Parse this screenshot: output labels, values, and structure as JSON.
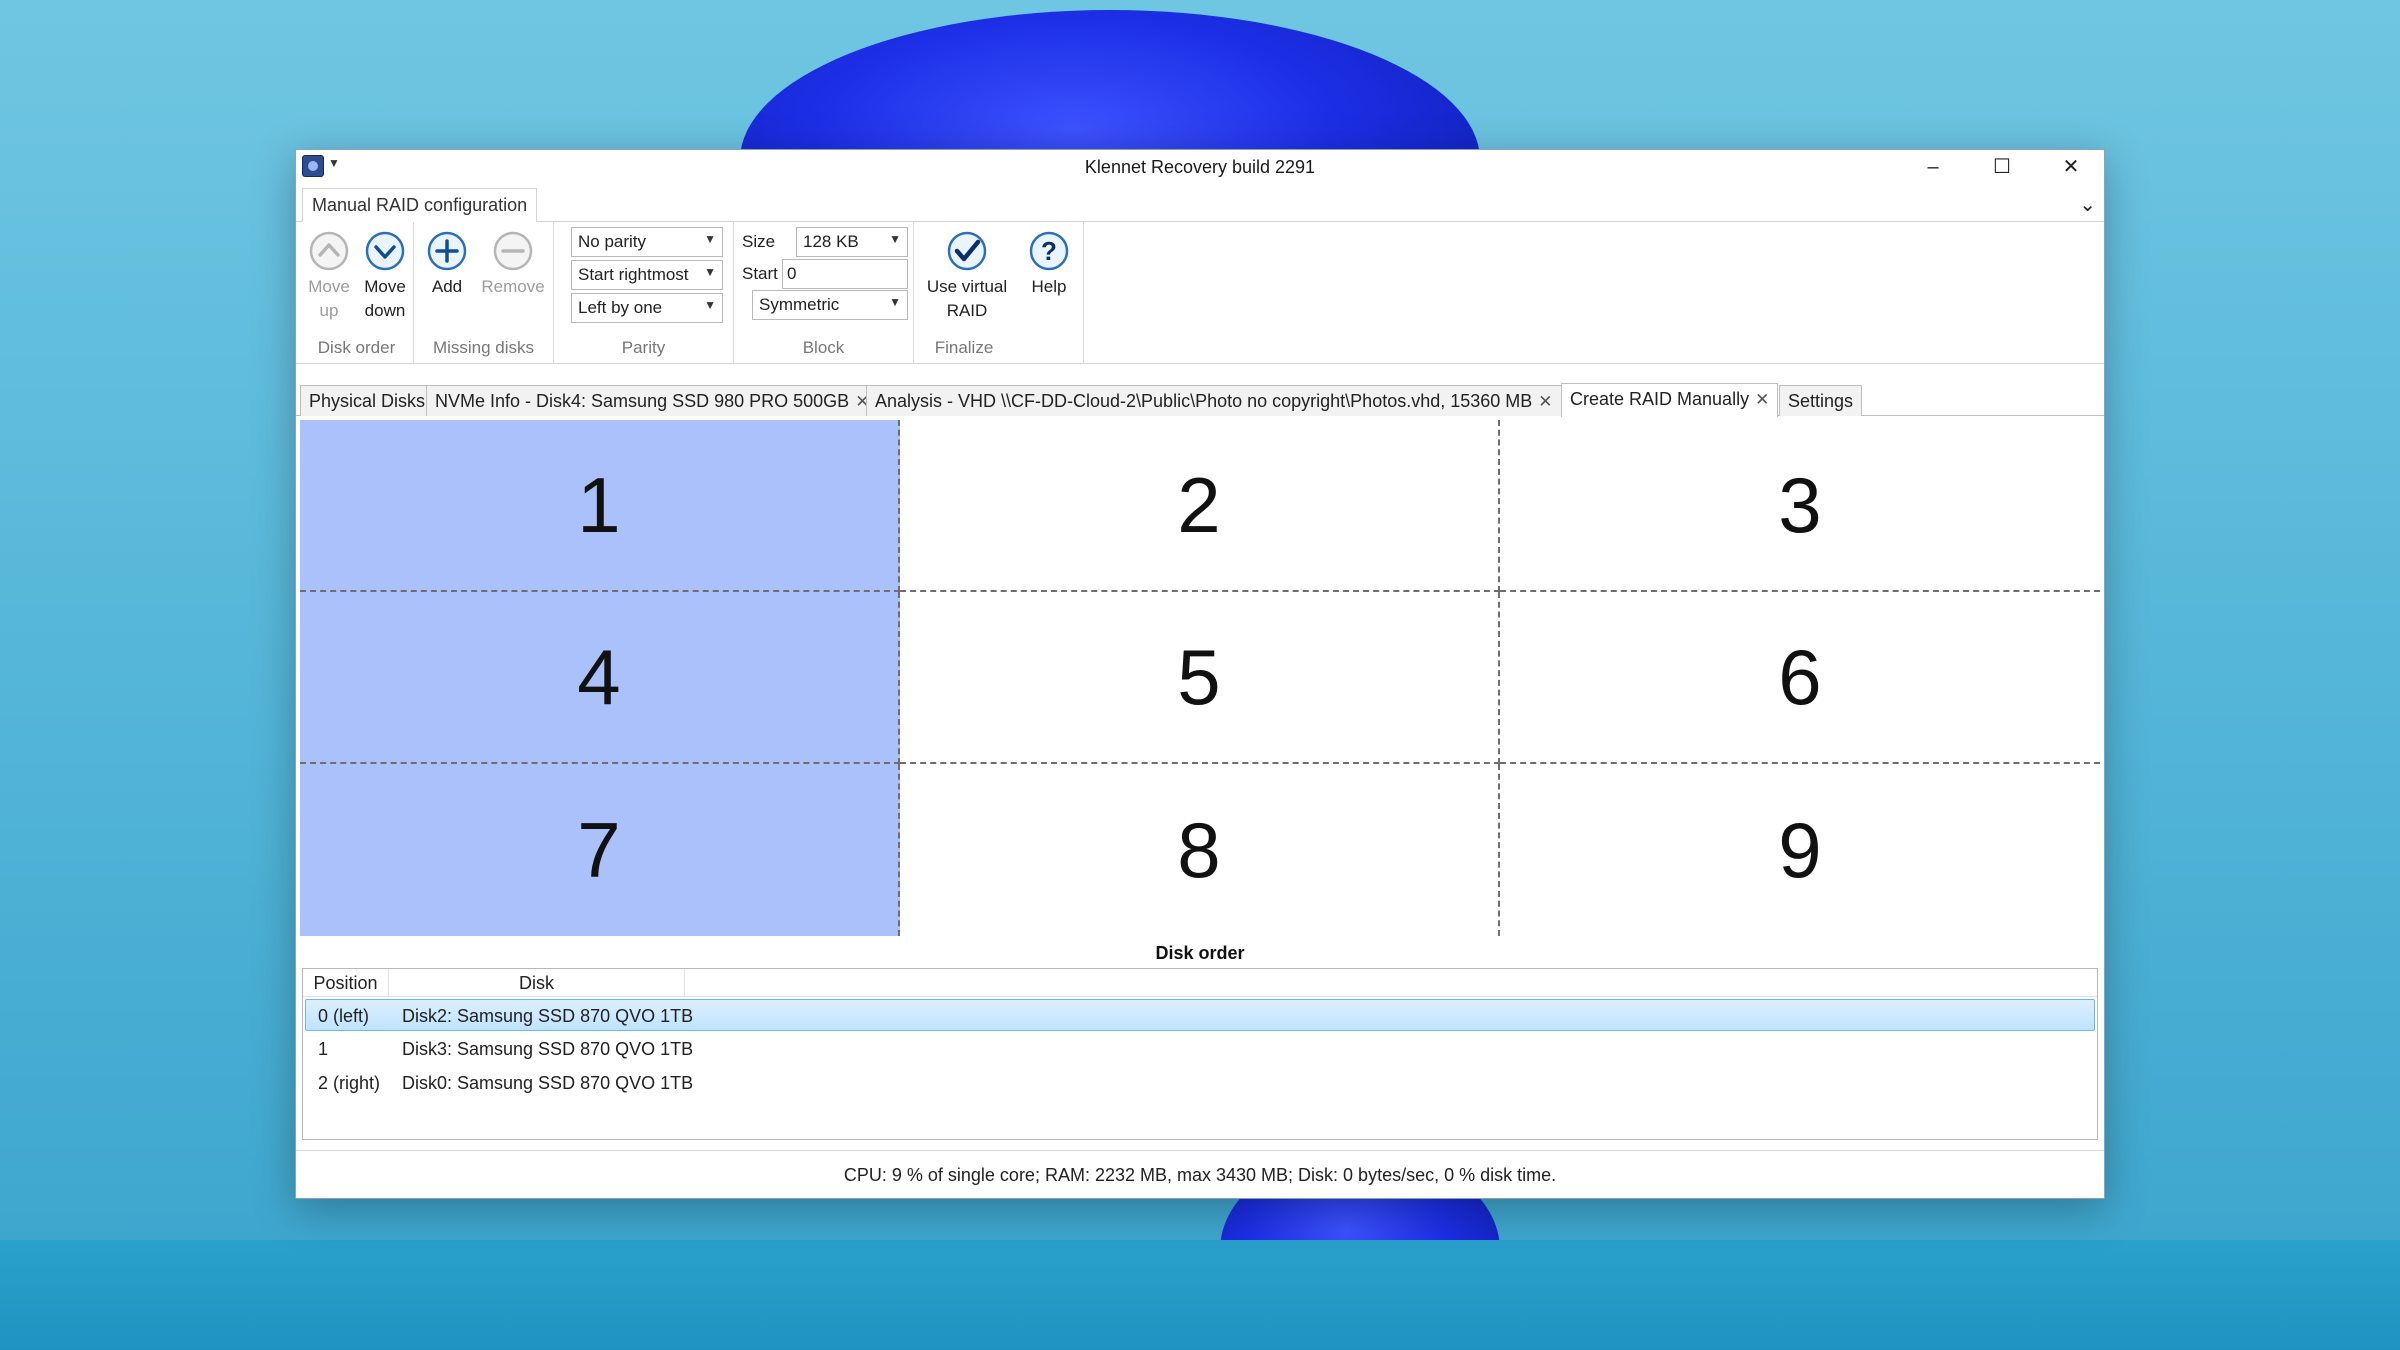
{
  "window": {
    "title": "Klennet Recovery build 2291",
    "minimize": "–",
    "maximize": "☐",
    "close": "✕"
  },
  "ribbon": {
    "tab_label": "Manual RAID configuration",
    "collapse": "⌄",
    "groups": {
      "disk_order": {
        "label": "Disk order",
        "move_up": "Move up",
        "move_down": "Move down"
      },
      "missing_disks": {
        "label": "Missing disks",
        "add": "Add",
        "remove": "Remove"
      },
      "parity": {
        "label": "Parity",
        "parity_type": "No parity",
        "start": "Start rightmost",
        "rotation": "Left by one"
      },
      "block": {
        "label": "Block",
        "size_label": "Size",
        "size_value": "128 KB",
        "start_label": "Start",
        "start_value": "0",
        "layout": "Symmetric"
      },
      "finalize": {
        "label": "Finalize",
        "use_virtual_raid": "Use virtual RAID",
        "help": "Help"
      }
    }
  },
  "doc_tabs": [
    {
      "label": "Physical Disks",
      "closable": false
    },
    {
      "label": "NVMe Info - Disk4:  Samsung SSD 980 PRO 500GB",
      "closable": true
    },
    {
      "label": "Analysis - VHD \\\\CF-DD-Cloud-2\\Public\\Photo no copyright\\Photos.vhd, 15360 MB",
      "closable": true
    },
    {
      "label": "Create RAID Manually",
      "closable": true,
      "active": true
    },
    {
      "label": "Settings",
      "closable": false
    }
  ],
  "stripe_grid": {
    "cells": [
      "1",
      "2",
      "3",
      "4",
      "5",
      "6",
      "7",
      "8",
      "9"
    ],
    "highlight_color": "#aac1fb"
  },
  "disk_order": {
    "caption": "Disk order",
    "columns": [
      "Position",
      "Disk"
    ],
    "rows": [
      {
        "position": "0 (left)",
        "disk": "Disk2:  Samsung SSD 870 QVO 1TB",
        "selected": true
      },
      {
        "position": "1",
        "disk": "Disk3:  Samsung SSD 870 QVO 1TB",
        "selected": false
      },
      {
        "position": "2 (right)",
        "disk": "Disk0:  Samsung SSD 870 QVO 1TB",
        "selected": false
      }
    ]
  },
  "status": {
    "text": "CPU: 9 % of single core; RAM: 2232 MB, max 3430 MB; Disk: 0 bytes/sec, 0 % disk time."
  }
}
